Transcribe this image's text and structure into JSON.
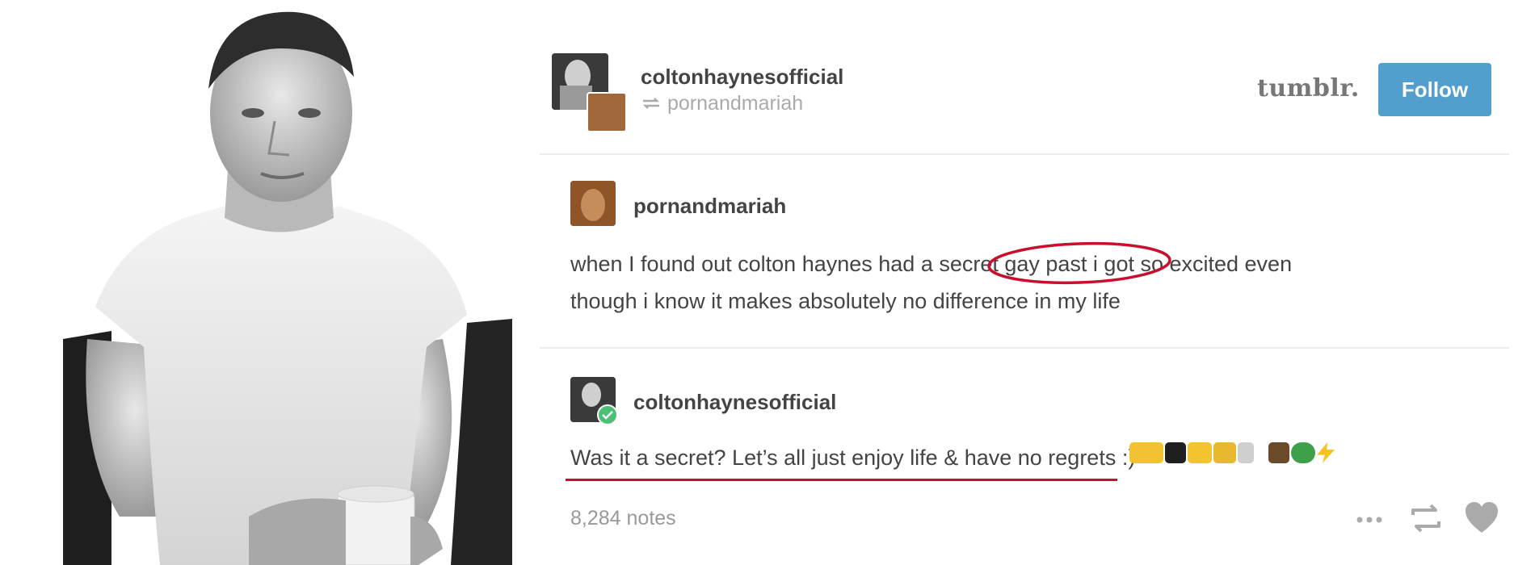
{
  "header": {
    "username": "coltonhaynesofficial",
    "reblogged_from": "pornandmariah",
    "brand": "tumblr.",
    "follow_label": "Follow"
  },
  "original_post": {
    "username": "pornandmariah",
    "line1": "when I found out colton haynes had a secret gay past i got so excited even",
    "line2": "though i know it makes absolutely no difference in my life"
  },
  "reply": {
    "username": "coltonhaynesofficial",
    "text": "Was it a secret? Let’s all just enjoy life & have no regrets :)"
  },
  "footer": {
    "notes": "8,284 notes"
  },
  "icons": [
    "reblog-icon",
    "more-icon",
    "heart-icon",
    "checkmark-badge-icon"
  ],
  "colors": {
    "follow_button": "#529ecc",
    "annotation_red": "#c8102e",
    "text": "#444444",
    "muted": "#999999"
  }
}
